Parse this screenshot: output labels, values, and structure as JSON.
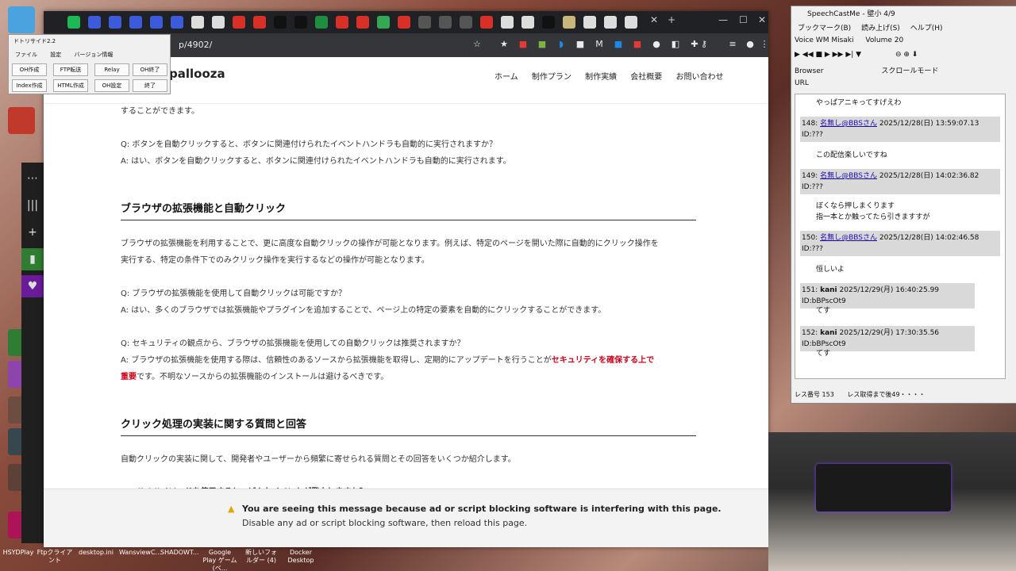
{
  "taskbar": {
    "apps": [
      "HSYDPlay",
      "Ftpクライアント",
      "desktop.ini",
      "WansviewC...",
      "SHADOWT...",
      "Google Play ゲーム (ベ...",
      "新しいフォルダー (4)",
      "Docker Desktop"
    ]
  },
  "tool_window": {
    "title": "ドトリサイド2.2",
    "menu": [
      "ファイル",
      "設定",
      "バージョン情報"
    ],
    "buttons": [
      "OH作成",
      "FTP転送",
      "Relay",
      "OH終了",
      "Index作成",
      "HTML作成",
      "OH設定",
      "終了"
    ]
  },
  "browser": {
    "url": "p/4902/",
    "site": {
      "logo": "pallooza",
      "nav": [
        "ホーム",
        "制作プラン",
        "制作実績",
        "会社概要",
        "お問い合わせ"
      ]
    },
    "content": {
      "p0": "することができます。",
      "qa1_q": "Q: ボタンを自動クリックすると、ボタンに関連付けられたイベントハンドラも自動的に実行されますか？",
      "qa1_a": "A: はい、ボタンを自動クリックすると、ボタンに関連付けられたイベントハンドラも自動的に実行されます。",
      "h_ext": "ブラウザの拡張機能と自動クリック",
      "ext_p1": "ブラウザの拡張機能を利用することで、更に高度な自動クリックの操作が可能となります。例えば、特定のページを開いた際に自動的にクリック操作を",
      "ext_p2": "実行する、特定の条件下でのみクリック操作を実行するなどの操作が可能となります。",
      "qa2_q": "Q: ブラウザの拡張機能を使用して自動クリックは可能ですか？",
      "qa2_a": "A: はい、多くのブラウザでは拡張機能やプラグインを追加することで、ページ上の特定の要素を自動的にクリックすることができます。",
      "qa3_q": "Q: セキュリティの観点から、ブラウザの拡張機能を使用しての自動クリックは推奨されますか？",
      "qa3_a1": "A: ブラウザの拡張機能を使用する際は、信頼性のあるソースから拡張機能を取得し、定期的にアップデートを行うことが",
      "qa3_red1": "セキュリティを確保する上で",
      "qa3_red2": "重要",
      "qa3_a2": "です。不明なソースからの拡張機能のインストールは避けるべきです。",
      "h_impl": "クリック処理の実装に関する質問と回答",
      "impl_p": "自動クリックの実装に関して、開発者やユーザーから頻繁に寄せられる質問とその回答をいくつか紹介します。",
      "qa4_q": "Q: click()メソッドを使用すると、どんなイベントが発火しますか？"
    },
    "adblock": {
      "line1": "You are seeing this message because ad or script blocking software is interfering with this page.",
      "line2": "Disable any ad or script blocking software, then reload this page."
    }
  },
  "speechcast": {
    "title": "SpeechCastMe - 壁小 4/9",
    "menu": [
      "ブックマーク(B)",
      "読み上げ(S)",
      "ヘルプ(H)"
    ],
    "voice": "Voice  WM Misaki",
    "volume": "Volume  20",
    "browser_label": "Browser",
    "url_label": "URL",
    "scroll_label": "スクロールモード",
    "top_text": "やっぱアニキってすげえわ",
    "posts": [
      {
        "no": "148:",
        "name": "名無し@BBSさん",
        "date": "2025/12/28(日) 13:59:07.13 ID:???",
        "body": "この配信楽しいですね"
      },
      {
        "no": "149:",
        "name": "名無し@BBSさん",
        "date": "2025/12/28(日) 14:02:36.82 ID:???",
        "body": "ぼくなら押しまくります"
      },
      {
        "no": "150:",
        "name": "名無し@BBSさん",
        "date": "2025/12/28(日) 14:02:46.58 ID:???",
        "body": "恒しいよ"
      },
      {
        "no": "151:",
        "name": "kani",
        "date": "2025/12/29(月) 16:40:25.99 ID:bBPscOt9",
        "body": "てす"
      },
      {
        "no": "152:",
        "name": "kani",
        "date": "2025/12/29(月) 17:30:35.56 ID:bBPscOt9",
        "body": "てす"
      }
    ],
    "body2_extra": "指一本とか触ってたら引きますすが",
    "status": [
      "レス番号 153",
      "レス取得まで後49・・・・"
    ]
  }
}
